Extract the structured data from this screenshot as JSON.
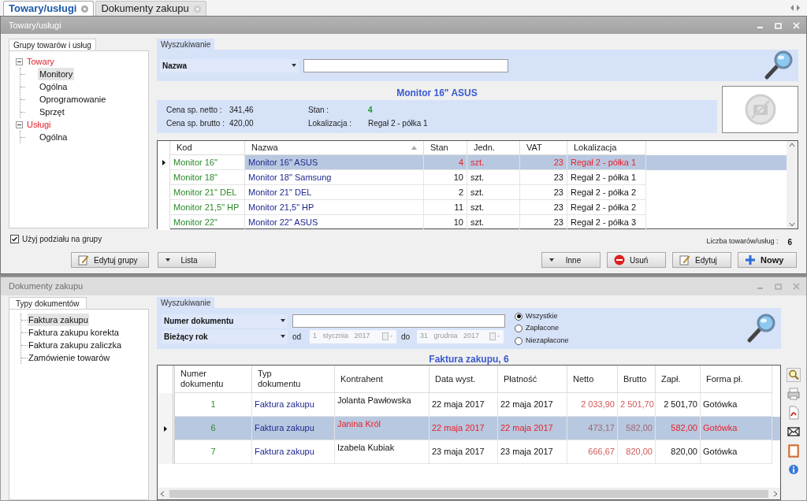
{
  "tabs": [
    {
      "label": "Towary/usługi",
      "selected": true
    },
    {
      "label": "Dokumenty zakupu",
      "selected": false
    }
  ],
  "products_window": {
    "title": "Towary/usługi",
    "groups_tab": "Grupy towarów i usług",
    "tree": [
      {
        "label": "Towary",
        "selected": false,
        "children": [
          {
            "label": "Monitory",
            "selected": true
          },
          {
            "label": "Ogólna",
            "selected": false
          },
          {
            "label": "Oprogramowanie",
            "selected": false
          },
          {
            "label": "Sprzęt",
            "selected": false
          }
        ]
      },
      {
        "label": "Usługi",
        "selected": false,
        "children": [
          {
            "label": "Ogólna",
            "selected": false
          }
        ]
      }
    ],
    "search_tab": "Wyszukiwanie",
    "search_by": "Nazwa",
    "product_title": "Monitor 16\" ASUS",
    "info": [
      {
        "label": "Cena sp. netto :",
        "value": "341,46",
        "color": "#222222"
      },
      {
        "label": "Cena sp. brutto :",
        "value": "420,00",
        "color": "#222222"
      },
      {
        "label": "Stan :",
        "value": "4",
        "color": "#1e9a1e"
      },
      {
        "label": "Lokalizacja :",
        "value": "Regał 2 - półka 1",
        "color": "#222222"
      }
    ],
    "columns": [
      "Kod",
      "Nazwa",
      "Stan",
      "Jedn.",
      "VAT",
      "Lokalizacja"
    ],
    "rows": [
      {
        "selected": true,
        "cells": [
          "Monitor 16\"",
          "Monitor 16\" ASUS",
          "4",
          "szt.",
          "23",
          "Regał 2 - półka 1"
        ]
      },
      {
        "selected": false,
        "cells": [
          "Monitor 18\"",
          "Monitor 18\" Samsung",
          "10",
          "szt.",
          "23",
          "Regał 2 - półka 1"
        ]
      },
      {
        "selected": false,
        "cells": [
          "Monitor 21\" DEL",
          "Monitor 21\" DEL",
          "2",
          "szt.",
          "23",
          "Regał 2 - półka 2"
        ]
      },
      {
        "selected": false,
        "cells": [
          "Monitor 21,5\" HP",
          "Monitor 21,5\" HP",
          "11",
          "szt.",
          "23",
          "Regał 2 - półka 2"
        ]
      },
      {
        "selected": false,
        "cells": [
          "Monitor 22\"",
          "Monitor 22\" ASUS",
          "10",
          "szt.",
          "23",
          "Regał 2 - półka 3"
        ]
      }
    ],
    "use_groups": {
      "label": "Użyj podziału na grupy",
      "checked": true
    },
    "count_label": "Liczba towarów/usług :",
    "count": "6",
    "left_buttons": [
      {
        "label": "Edytuj grupy",
        "kind": "edit"
      },
      {
        "label": "Lista",
        "kind": "menu"
      }
    ],
    "right_buttons": [
      {
        "label": "Inne",
        "kind": "menu"
      },
      {
        "label": "Usuń",
        "kind": "delete"
      },
      {
        "label": "Edytuj",
        "kind": "edit"
      },
      {
        "label": "Nowy",
        "kind": "add"
      }
    ]
  },
  "documents_window": {
    "title": "Dokumenty zakupu",
    "types_tab": "Typy dokumentów",
    "types": [
      {
        "label": "Faktura zakupu",
        "selected": true
      },
      {
        "label": "Faktura zakupu korekta",
        "selected": false
      },
      {
        "label": "Faktura zakupu zaliczka",
        "selected": false
      },
      {
        "label": "Zamówienie towarów",
        "selected": false
      }
    ],
    "search_tab": "Wyszukiwanie",
    "search_by": "Numer dokumentu",
    "period": "Bieżący rok",
    "from_label": "od",
    "date_from": "1   stycznia   2017",
    "to_label": "do",
    "date_to": "31   grudnia   2017",
    "filters": [
      {
        "label": "Wszystkie",
        "selected": true
      },
      {
        "label": "Zapłacone",
        "selected": false
      },
      {
        "label": "Niezapłacone",
        "selected": false
      }
    ],
    "list_title": "Faktura zakupu, 6",
    "columns": [
      "Numer dokumentu",
      "Typ dokumentu",
      "Kontrahent",
      "Data wyst.",
      "Płatność",
      "Netto",
      "Brutto",
      "Zapł.",
      "Forma pł."
    ],
    "rows": [
      {
        "selected": false,
        "cells": [
          "1",
          "Faktura zakupu",
          "Jolanta Pawłowska",
          "22 maja 2017",
          "22 maja 2017",
          "2 033,90",
          "2 501,70",
          "2 501,70",
          "Gotówka"
        ]
      },
      {
        "selected": true,
        "cells": [
          "6",
          "Faktura zakupu",
          "Janina Król",
          "22 maja 2017",
          "22 maja 2017",
          "473,17",
          "582,00",
          "582,00",
          "Gotówka"
        ]
      },
      {
        "selected": false,
        "cells": [
          "7",
          "Faktura zakupu",
          "Izabela Kubiak",
          "23 maja 2017",
          "23 maja 2017",
          "666,67",
          "820,00",
          "820,00",
          "Gotówka"
        ]
      }
    ]
  }
}
